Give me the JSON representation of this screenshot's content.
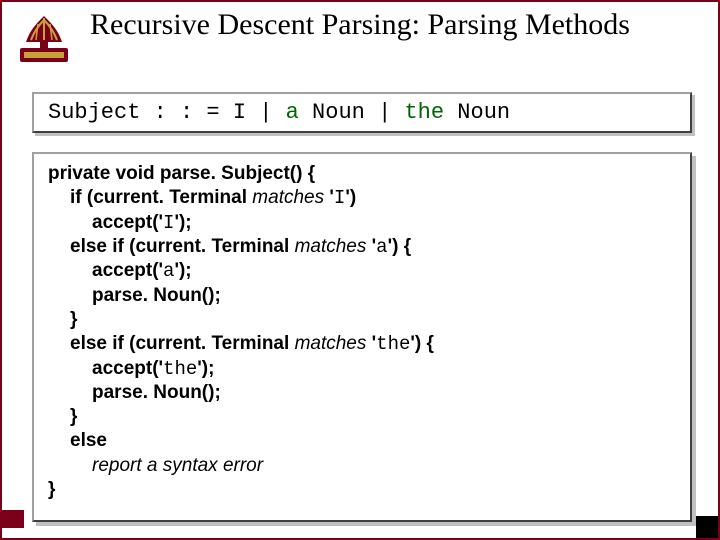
{
  "title": "Recursive Descent Parsing: Parsing Methods",
  "grammar": {
    "lhs": "Subject",
    "op": " : : = ",
    "rhs_plain1": "I | ",
    "rhs_kw1": "a",
    "rhs_plain2": " Noun | ",
    "rhs_kw2": "the",
    "rhs_plain3": " Noun"
  },
  "code": {
    "l1a": "private void parse. Subject() {",
    "l2a": "if (current. Terminal ",
    "l2b": "matches",
    "l2c": " '",
    "l2d": "I",
    "l2e": "')",
    "l3a": "accept('",
    "l3b": "I",
    "l3c": "');",
    "l4a": "else if (current. Terminal ",
    "l4b": "matches",
    "l4c": " '",
    "l4d": "a",
    "l4e": "') {",
    "l5a": "accept('",
    "l5b": "a",
    "l5c": "');",
    "l6": "parse. Noun();",
    "l7": "}",
    "l8a": "else if (current. Terminal ",
    "l8b": "matches",
    "l8c": " '",
    "l8d": "the",
    "l8e": "') {",
    "l9a": "accept('",
    "l9b": "the",
    "l9c": "');",
    "l10": "parse. Noun();",
    "l11": "}",
    "l12": "else",
    "l13": "report a syntax error",
    "l14": "}"
  }
}
